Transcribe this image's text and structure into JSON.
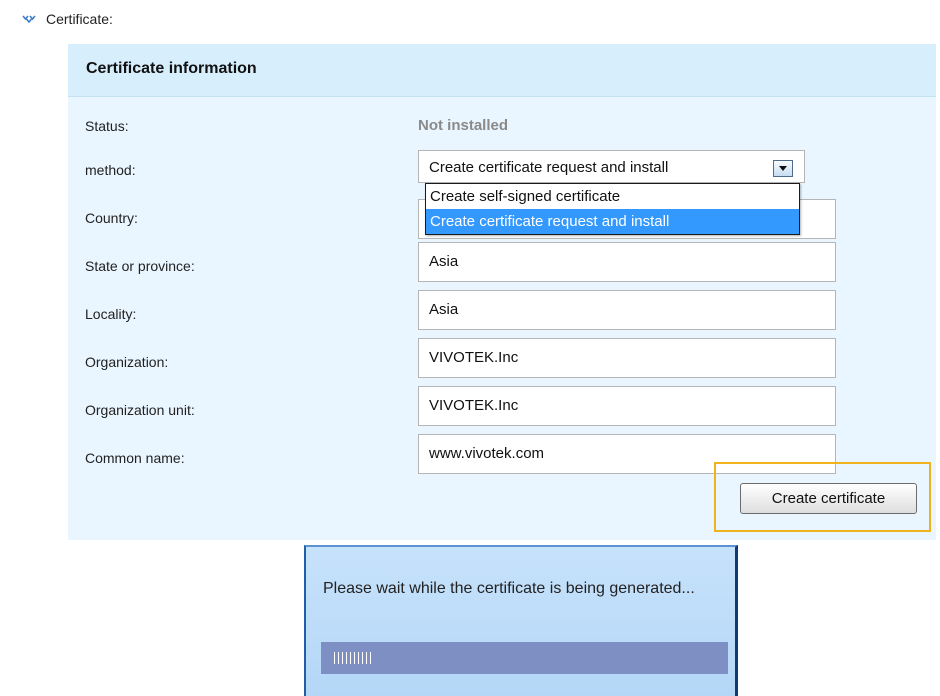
{
  "section": {
    "title": "Certificate:"
  },
  "panel": {
    "title": "Certificate information"
  },
  "status": {
    "label": "Status:",
    "value": "Not installed"
  },
  "method": {
    "label": "method:",
    "selected": "Create certificate request and install",
    "options": [
      "Create self-signed certificate",
      "Create certificate request and install"
    ]
  },
  "fields": {
    "country": {
      "label": "Country:"
    },
    "state": {
      "label": "State or province:",
      "value": "Asia"
    },
    "locality": {
      "label": "Locality:",
      "value": "Asia"
    },
    "organization": {
      "label": "Organization:",
      "value": "VIVOTEK.Inc"
    },
    "unit": {
      "label": "Organization unit:",
      "value": "VIVOTEK.Inc"
    },
    "common_name": {
      "label": "Common name:",
      "value": "www.vivotek.com"
    }
  },
  "create_button": {
    "label": "Create certificate"
  },
  "wait_dialog": {
    "message": "Please wait while the certificate is being generated...",
    "progress_ticks": 10
  },
  "colors": {
    "highlight": "#f0b21f",
    "selected_option": "#3399ff",
    "progress": "#7e8fc4"
  },
  "icons": {
    "section": "expand-arrows-icon",
    "select": "dropdown-arrow-icon"
  }
}
